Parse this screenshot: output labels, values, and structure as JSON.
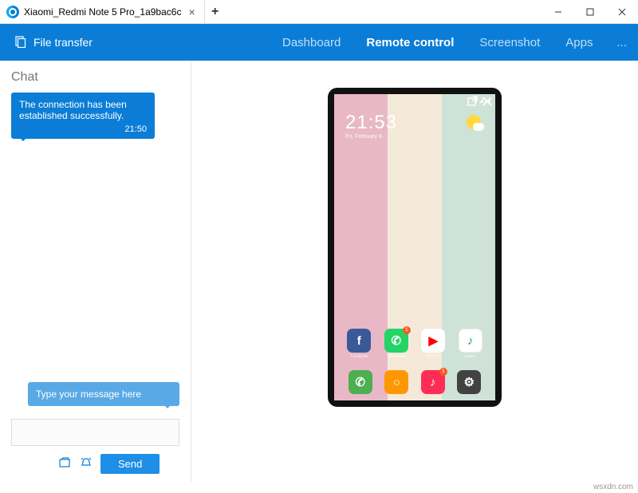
{
  "window": {
    "tab_title": "Xiaomi_Redmi Note 5 Pro_1a9bac6c"
  },
  "header": {
    "file_transfer_label": "File transfer",
    "nav": {
      "dashboard": "Dashboard",
      "remote_control": "Remote control",
      "screenshot": "Screenshot",
      "apps": "Apps",
      "more": "..."
    }
  },
  "chat": {
    "title": "Chat",
    "message": "The connection has been established successfully.",
    "message_time": "21:50",
    "prompt": "Type your message here",
    "send_label": "Send"
  },
  "phone": {
    "clock_time": "21:53",
    "clock_date": "Fri, February 8",
    "apps_row1": [
      {
        "name": "facebook",
        "label": "Facebook",
        "glyph": "f",
        "cls": "fb",
        "badge": ""
      },
      {
        "name": "whatsapp",
        "label": "WhatsApp",
        "glyph": "✆",
        "cls": "wa",
        "badge": "1"
      },
      {
        "name": "youtube",
        "label": "YouTube",
        "glyph": "▶",
        "cls": "yt",
        "badge": ""
      },
      {
        "name": "saavn",
        "label": "Saavn",
        "glyph": "♪",
        "cls": "sv",
        "badge": ""
      }
    ],
    "dock": [
      {
        "name": "phone",
        "glyph": "✆",
        "cls": "ph",
        "badge": ""
      },
      {
        "name": "browser",
        "glyph": "○",
        "cls": "mi",
        "badge": ""
      },
      {
        "name": "music",
        "glyph": "♪",
        "cls": "tk",
        "badge": "1"
      },
      {
        "name": "settings",
        "glyph": "⚙",
        "cls": "st",
        "badge": ""
      }
    ]
  },
  "watermark": "wsxdn.com"
}
